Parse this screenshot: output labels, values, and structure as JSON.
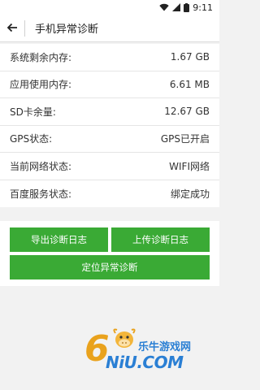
{
  "status_bar": {
    "time": "9:11"
  },
  "app_bar": {
    "title": "手机异常诊断",
    "back_icon": "back-arrow-icon"
  },
  "info_rows": [
    {
      "label": "系统剩余内存:",
      "value": "1.67 GB"
    },
    {
      "label": "应用使用内存:",
      "value": "6.61 MB"
    },
    {
      "label": "SD卡余量:",
      "value": "12.67 GB"
    },
    {
      "label": "GPS状态:",
      "value": "GPS已开启"
    },
    {
      "label": "当前网络状态:",
      "value": "WIFI网络"
    },
    {
      "label": "百度服务状态:",
      "value": "绑定成功"
    }
  ],
  "buttons": {
    "export_log": "导出诊断日志",
    "upload_log": "上传诊断日志",
    "locate_diagnosis": "定位异常诊断"
  },
  "watermark": {
    "brand_cn": "乐牛游戏网",
    "brand_en": "NiU.COM",
    "digit": "6"
  },
  "colors": {
    "button_green": "#3aaa35",
    "watermark_orange": "#e9a21d",
    "watermark_blue": "#2a7fd4"
  }
}
